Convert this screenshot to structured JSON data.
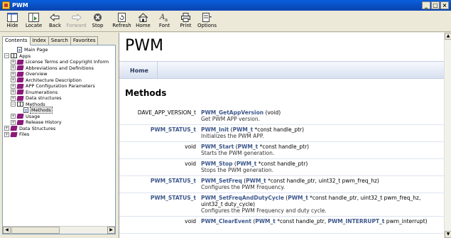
{
  "window": {
    "title": "PWM"
  },
  "toolbar": {
    "hide": "Hide",
    "locate": "Locate",
    "back": "Back",
    "forward": "Forward",
    "stop": "Stop",
    "refresh": "Refresh",
    "home": "Home",
    "font": "Font",
    "print": "Print",
    "options": "Options"
  },
  "left": {
    "tabs": [
      "Contents",
      "Index",
      "Search",
      "Favorites"
    ],
    "tree": [
      {
        "label": "Main Page",
        "icon": "page",
        "level": 1,
        "exp": ""
      },
      {
        "label": "Apps",
        "icon": "book-open",
        "level": 0,
        "exp": "−"
      },
      {
        "label": "License Terms and Copyright Inform",
        "icon": "book",
        "level": 1,
        "exp": "+"
      },
      {
        "label": "Abbreviations and Definitions",
        "icon": "book",
        "level": 1,
        "exp": "+"
      },
      {
        "label": "Overview",
        "icon": "book",
        "level": 1,
        "exp": "+"
      },
      {
        "label": "Architecture Description",
        "icon": "book",
        "level": 1,
        "exp": "+"
      },
      {
        "label": "APP Configuration Parameters",
        "icon": "book",
        "level": 1,
        "exp": "+"
      },
      {
        "label": "Enumerations",
        "icon": "book",
        "level": 1,
        "exp": "+"
      },
      {
        "label": "Data structures",
        "icon": "book",
        "level": 1,
        "exp": "+"
      },
      {
        "label": "Methods",
        "icon": "book-open",
        "level": 1,
        "exp": "−"
      },
      {
        "label": "Methods",
        "icon": "page",
        "level": 2,
        "exp": "",
        "selected": true
      },
      {
        "label": "Usage",
        "icon": "book",
        "level": 1,
        "exp": "+"
      },
      {
        "label": "Release History",
        "icon": "book",
        "level": 1,
        "exp": "+"
      },
      {
        "label": "Data Structures",
        "icon": "book",
        "level": 0,
        "exp": "+"
      },
      {
        "label": "Files",
        "icon": "book",
        "level": 0,
        "exp": "+"
      }
    ]
  },
  "content": {
    "page_title": "PWM",
    "nav_home": "Home",
    "section_title": "Methods",
    "methods": [
      {
        "ret": "DAVE_APP_VERSION_t",
        "ret_link": false,
        "sig": [
          [
            "fn",
            "PWM_GetAppVersion"
          ],
          [
            "t",
            " (void)"
          ]
        ],
        "desc": "Get PWM APP version.",
        "lines": 1
      },
      {
        "ret": "PWM_STATUS_t",
        "ret_link": true,
        "sig": [
          [
            "fn",
            "PWM_Init"
          ],
          [
            "t",
            " ("
          ],
          [
            "ty",
            "PWM_t"
          ],
          [
            "t",
            " *const handle_ptr)"
          ]
        ],
        "desc": "Initializes the PWM APP.",
        "lines": 1
      },
      {
        "ret": "void",
        "ret_link": false,
        "sig": [
          [
            "fn",
            "PWM_Start"
          ],
          [
            "t",
            " ("
          ],
          [
            "ty",
            "PWM_t"
          ],
          [
            "t",
            " *const handle_ptr)"
          ]
        ],
        "desc": "Starts the PWM generation.",
        "lines": 1
      },
      {
        "ret": "void",
        "ret_link": false,
        "sig": [
          [
            "fn",
            "PWM_Stop"
          ],
          [
            "t",
            " ("
          ],
          [
            "ty",
            "PWM_t"
          ],
          [
            "t",
            " *const handle_ptr)"
          ]
        ],
        "desc": "Stops the PWM generation.",
        "lines": 1
      },
      {
        "ret": "PWM_STATUS_t",
        "ret_link": true,
        "sig": [
          [
            "fn",
            "PWM_SetFreq"
          ],
          [
            "t",
            " ("
          ],
          [
            "ty",
            "PWM_t"
          ],
          [
            "t",
            " *const handle_ptr, uint32_t pwm_freq_hz)"
          ]
        ],
        "desc": "Configures the PWM Frequency.",
        "lines": 1
      },
      {
        "ret": "PWM_STATUS_t",
        "ret_link": true,
        "sig": [
          [
            "fn",
            "PWM_SetFreqAndDutyCycle"
          ],
          [
            "t",
            " ("
          ],
          [
            "ty",
            "PWM_t"
          ],
          [
            "t",
            " *const handle_ptr, uint32_t pwm_freq_hz, uint32_t duty_cycle)"
          ]
        ],
        "desc": "Configures the PWM Frequency and duty cycle.",
        "lines": 2
      },
      {
        "ret": "void",
        "ret_link": false,
        "sig": [
          [
            "fn",
            "PWM_ClearEvent"
          ],
          [
            "t",
            " ("
          ],
          [
            "ty",
            "PWM_t"
          ],
          [
            "t",
            " *const handle_ptr, "
          ],
          [
            "ty",
            "PWM_INTERRUPT_t"
          ],
          [
            "t",
            " pwm_interrupt)"
          ]
        ],
        "desc": "",
        "lines": 2
      }
    ]
  }
}
